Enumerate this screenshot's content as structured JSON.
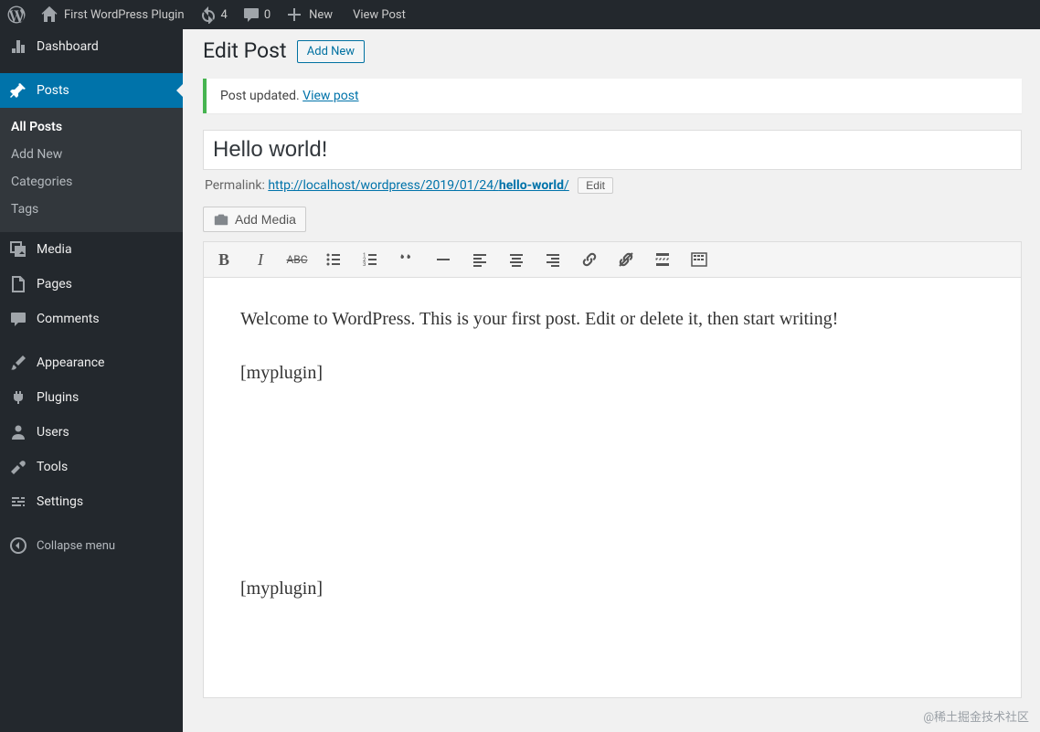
{
  "toolbar": {
    "site_name": "First WordPress Plugin",
    "updates_count": "4",
    "comments_count": "0",
    "new_label": "New",
    "view_post_label": "View Post"
  },
  "sidebar": {
    "dashboard": "Dashboard",
    "posts": "Posts",
    "posts_submenu": {
      "all": "All Posts",
      "add": "Add New",
      "cats": "Categories",
      "tags": "Tags"
    },
    "media": "Media",
    "pages": "Pages",
    "comments": "Comments",
    "appearance": "Appearance",
    "plugins": "Plugins",
    "users": "Users",
    "tools": "Tools",
    "settings": "Settings",
    "collapse": "Collapse menu"
  },
  "page": {
    "heading": "Edit Post",
    "add_new": "Add New",
    "notice_text": "Post updated. ",
    "notice_link": "View post",
    "title_value": "Hello world!",
    "permalink_label": "Permalink: ",
    "permalink_base": "http://localhost/wordpress/2019/01/24/",
    "permalink_slug": "hello-world",
    "permalink_trail": "/",
    "permalink_edit": "Edit",
    "add_media": "Add Media"
  },
  "editor": {
    "p1": "Welcome to WordPress. This is your first post. Edit or delete it, then start writing!",
    "p2": "[myplugin]",
    "p3": "[myplugin]"
  },
  "watermark": "@稀土掘金技术社区"
}
